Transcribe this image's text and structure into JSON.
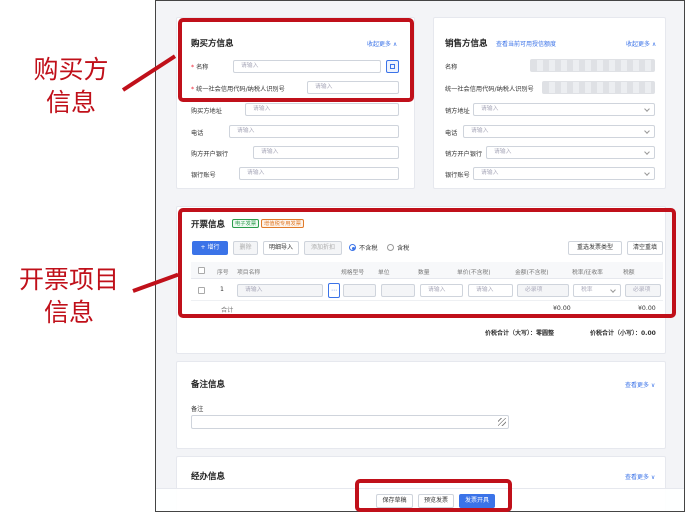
{
  "buyer": {
    "title": "购买方信息",
    "collapse_link": "收起更多 ∧",
    "name_label": "名称",
    "name_placeholder": "请输入",
    "taxid_label": "统一社会信用代码/纳税人识别号",
    "taxid_placeholder": "请输入",
    "address_label": "购买方地址",
    "address_placeholder": "请输入",
    "phone_label": "电话",
    "phone_placeholder": "请输入",
    "bank_label": "购方开户银行",
    "bank_placeholder": "请输入",
    "account_label": "银行账号",
    "account_placeholder": "请输入"
  },
  "seller": {
    "title": "销售方信息",
    "view_link": "查看当前可用授信额度",
    "collapse_link": "收起更多 ∧",
    "name_label": "名称",
    "taxid_label": "统一社会信用代码/纳税人识别号",
    "address_label": "销方地址",
    "address_placeholder": "请输入",
    "phone_label": "电话",
    "phone_placeholder": "请输入",
    "bank_label": "销方开户银行",
    "bank_placeholder": "请输入",
    "account_label": "银行账号",
    "account_placeholder": "请输入"
  },
  "invoice": {
    "title": "开票信息",
    "tag_electronic": "电子发票",
    "tag_normal": "增值税专用发票",
    "add_row": "+ 增行",
    "delete": "删除",
    "detail_import": "明细导入",
    "add_discount": "添加折扣",
    "radio_excl": "不含税",
    "radio_incl": "含税",
    "reselect_type": "重选发票类型",
    "clear_refill": "清空重填",
    "columns": [
      "序号",
      "项目名称",
      "规格型号",
      "单位",
      "数量",
      "单价(不含税)",
      "金额(不含税)",
      "税率/征收率",
      "税额"
    ],
    "row_index": "1",
    "row_name_placeholder": "请输入",
    "row_qty_placeholder": "请输入",
    "row_price_placeholder": "请输入",
    "row_amount_placeholder": "必录项",
    "row_rate_value": "税率",
    "row_tax_placeholder": "必录项",
    "total_label": "合计",
    "total_amount": "¥0.00",
    "total_tax": "¥0.00",
    "total_in_words": "价税合计（大写）：零圆整",
    "total_in_figures": "价税合计（小写）：0.00"
  },
  "remark": {
    "title": "备注信息",
    "view_more": "查看更多 ∨",
    "field_label": "备注"
  },
  "handler": {
    "title": "经办信息",
    "view_more": "查看更多 ∨"
  },
  "footer": {
    "save_draft": "保存草稿",
    "preview": "预览发票",
    "issue": "发票开具"
  },
  "annotations": {
    "buyer_label": "购买方\n信息",
    "items_label": "开票项目\n信息"
  },
  "colors": {
    "accent": "#3b73e8",
    "annotation_red": "#c0101a"
  }
}
